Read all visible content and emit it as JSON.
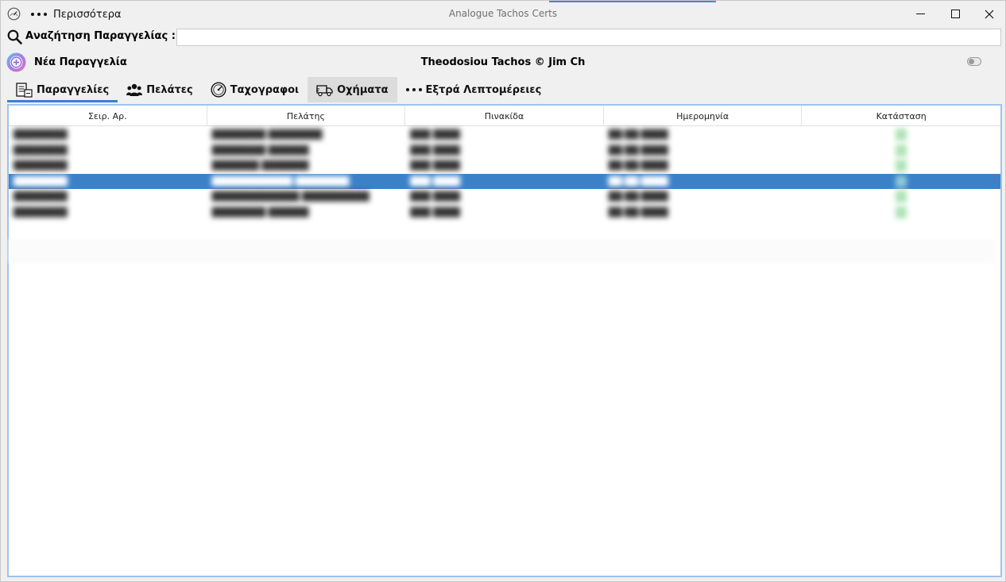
{
  "window": {
    "title": "Analogue Tachos Certs",
    "more_label": "Περισσότερα",
    "minimize": "minimize",
    "maximize": "maximize",
    "close": "close"
  },
  "search": {
    "label": "Αναζήτηση Παραγγελίας :",
    "value": "",
    "placeholder": ""
  },
  "toolbar": {
    "new_order_label": "Νέα Παραγγελία",
    "center_caption": "Theodosiou Tachos © Jim Ch",
    "toggle_on": false
  },
  "tabs": [
    {
      "label": "Παραγγελίες",
      "icon": "orders-icon",
      "active": true
    },
    {
      "label": "Πελάτες",
      "icon": "users-icon",
      "active": false
    },
    {
      "label": "Ταχογραφοι",
      "icon": "tachograph-icon",
      "active": false
    },
    {
      "label": "Οχήματα",
      "icon": "truck-icon",
      "active": false
    },
    {
      "label": "Εξτρά Λεπτομέρειες",
      "icon": "more-dots-icon",
      "active": false
    }
  ],
  "table": {
    "columns": [
      "Σειρ. Αρ.",
      "Πελάτης",
      "Πινακίδα",
      "Ημερομηνία",
      "Κατάσταση"
    ],
    "rows": [
      {
        "serial": "████████",
        "customer": "████████ ████████",
        "plate": "███ ████",
        "date": "██/██/████",
        "status": "",
        "selected": false
      },
      {
        "serial": "████████",
        "customer": "████████ ██████",
        "plate": "███ ████",
        "date": "██/██/████",
        "status": "",
        "selected": false
      },
      {
        "serial": "████████",
        "customer": "███████ ███████",
        "plate": "███ ████",
        "date": "██/██/████",
        "status": "",
        "selected": false
      },
      {
        "serial": "████████",
        "customer": "████████████ ████████",
        "plate": "███ ████",
        "date": "██/██/████",
        "status": "",
        "selected": true
      },
      {
        "serial": "████████",
        "customer": "█████████████ ██████████",
        "plate": "███ ████",
        "date": "██/██/████",
        "status": "",
        "selected": false
      },
      {
        "serial": "████████",
        "customer": "████████ ██████",
        "plate": "███ ████",
        "date": "██/██/████",
        "status": "",
        "selected": false
      }
    ]
  },
  "colors": {
    "accent": "#3d7fd0",
    "selected_row": "#3c80c8",
    "status_ok": "#aee3b6",
    "table_border": "#9fc3ee"
  }
}
